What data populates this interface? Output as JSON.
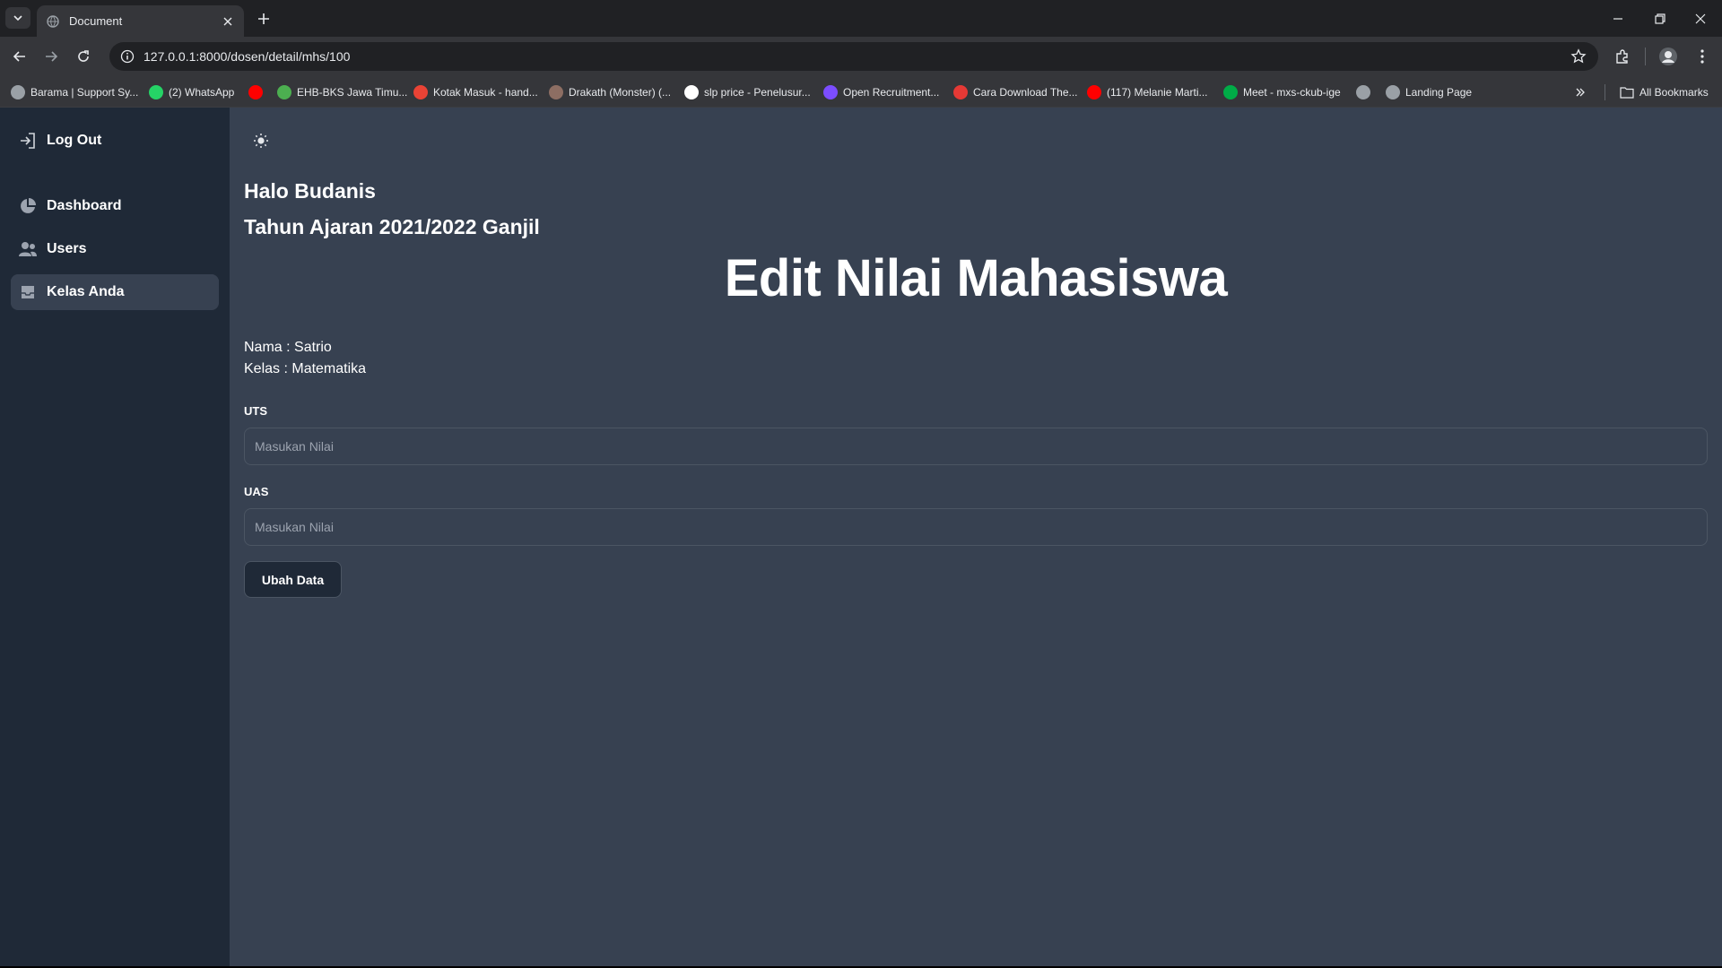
{
  "browser": {
    "tab_title": "Document",
    "url": "127.0.0.1:8000/dosen/detail/mhs/100",
    "bookmarks": [
      {
        "label": "Barama | Support Sy...",
        "icon": "globe-icon",
        "color": "#9aa0a6"
      },
      {
        "label": "(2) WhatsApp",
        "icon": "whatsapp-icon",
        "color": "#25d366"
      },
      {
        "label": "",
        "icon": "youtube-icon",
        "color": "#ff0000"
      },
      {
        "label": "EHB-BKS Jawa Timu...",
        "icon": "ehb-icon",
        "color": "#4caf50"
      },
      {
        "label": "Kotak Masuk - hand...",
        "icon": "gmail-icon",
        "color": "#ea4335"
      },
      {
        "label": "Drakath (Monster) (...",
        "icon": "drakath-icon",
        "color": "#8d6e63"
      },
      {
        "label": "slp price - Penelusur...",
        "icon": "google-icon",
        "color": "#ffffff"
      },
      {
        "label": "Open Recruitment...",
        "icon": "forms-icon",
        "color": "#7c4dff"
      },
      {
        "label": "Cara Download The...",
        "icon": "s-icon",
        "color": "#e53935"
      },
      {
        "label": "(117) Melanie Marti...",
        "icon": "youtube-icon",
        "color": "#ff0000"
      },
      {
        "label": "Meet - mxs-ckub-ige",
        "icon": "meet-icon",
        "color": "#00ac47"
      },
      {
        "label": "",
        "icon": "globe-icon",
        "color": "#9aa0a6"
      },
      {
        "label": "Landing Page",
        "icon": "globe-icon",
        "color": "#9aa0a6"
      }
    ],
    "all_bookmarks": "All Bookmarks"
  },
  "sidebar": {
    "logout": "Log Out",
    "items": [
      {
        "label": "Dashboard",
        "icon": "pie-chart-icon"
      },
      {
        "label": "Users",
        "icon": "users-icon"
      },
      {
        "label": "Kelas Anda",
        "icon": "inbox-icon"
      }
    ]
  },
  "main": {
    "greeting": "Halo Budanis",
    "academic_year": "Tahun Ajaran 2021/2022 Ganjil",
    "title": "Edit Nilai Mahasiswa",
    "nama": "Nama : Satrio",
    "kelas": "Kelas : Matematika",
    "uts_label": "UTS",
    "uts_placeholder": "Masukan Nilai",
    "uas_label": "UAS",
    "uas_placeholder": "Masukan Nilai",
    "submit": "Ubah Data"
  },
  "colors": {
    "sidebar_bg": "#1f2937",
    "main_bg": "#374151",
    "active_item_bg": "#374151",
    "chrome_dark": "#202124",
    "chrome_toolbar": "#35363a"
  }
}
